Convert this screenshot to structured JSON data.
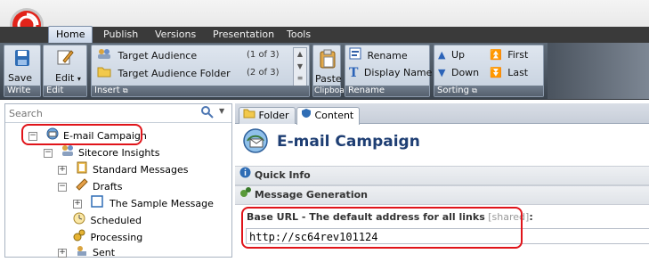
{
  "ribbon": {
    "tabs": [
      {
        "label": "Home"
      },
      {
        "label": "Publish"
      },
      {
        "label": "Versions"
      },
      {
        "label": "Presentation"
      },
      {
        "label": "Tools"
      }
    ],
    "write_group": {
      "save_label": "Save",
      "group_label": "Write"
    },
    "edit_group": {
      "edit_label": "Edit",
      "group_label": "Edit"
    },
    "insert_group": {
      "items": [
        {
          "label": "Target Audience",
          "count": "(1 of 3)"
        },
        {
          "label": "Target Audience Folder",
          "count": "(2 of 3)"
        }
      ],
      "group_label": "Insert"
    },
    "clipboard_group": {
      "paste_label": "Paste",
      "group_label": "Clipboard"
    },
    "rename_group": {
      "rename_label": "Rename",
      "display_name_label": "Display Name",
      "group_label": "Rename"
    },
    "sorting_group": {
      "up_label": "Up",
      "first_label": "First",
      "down_label": "Down",
      "last_label": "Last",
      "group_label": "Sorting"
    }
  },
  "tree": {
    "search_placeholder": "Search",
    "items": [
      {
        "label": "E-mail Campaign"
      },
      {
        "label": "Sitecore Insights"
      },
      {
        "label": "Standard Messages"
      },
      {
        "label": "Drafts"
      },
      {
        "label": "The Sample Message"
      },
      {
        "label": "Scheduled"
      },
      {
        "label": "Processing"
      },
      {
        "label": "Sent"
      }
    ]
  },
  "content": {
    "tabs": [
      {
        "label": "Folder"
      },
      {
        "label": "Content"
      }
    ],
    "title": "E-mail Campaign",
    "sections": [
      {
        "label": "Quick Info"
      },
      {
        "label": "Message Generation"
      }
    ],
    "field": {
      "label": "Base URL - The default address for all links",
      "shared": "[shared]",
      "suffix": ":",
      "value": "http://sc64rev101124"
    }
  }
}
